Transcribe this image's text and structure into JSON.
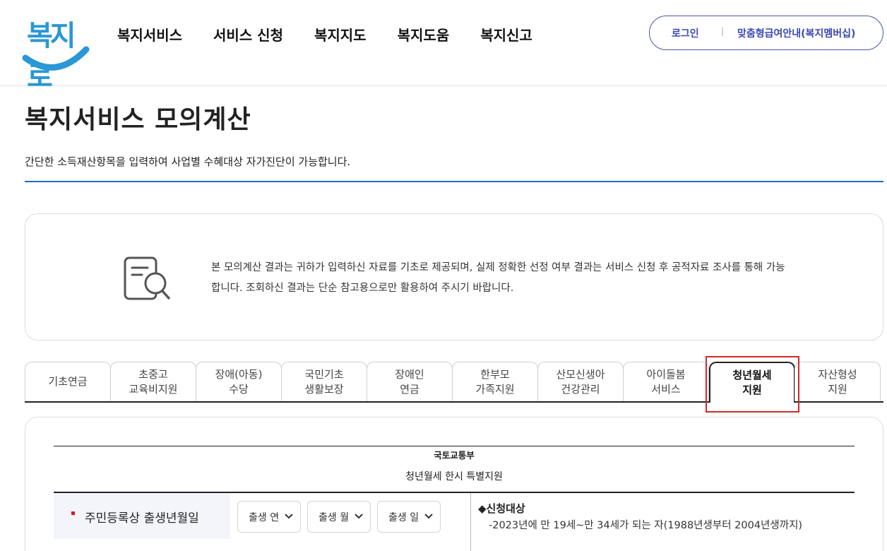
{
  "header": {
    "logo_text": "복지로",
    "nav": [
      "복지서비스",
      "서비스 신청",
      "복지지도",
      "복지도움",
      "복지신고"
    ],
    "util": {
      "login": "로그인",
      "separator": "|",
      "member": "맞춤형급여안내(복지멤버십)"
    }
  },
  "page": {
    "title": "복지서비스 모의계산",
    "description": "간단한 소득재산항목을 입력하여 사업별 수혜대상 자가진단이 가능합니다."
  },
  "notice": {
    "icon": "document-search-icon",
    "text": "본 모의계산 결과는 귀하가 입력하신 자료를 기초로 제공되며, 실제 정확한 선정 여부 결과는 서비스 신청 후 공적자료 조사를 통해 가능합니다. 조회하신 결과는 단순 참고용으로만 활용하여 주시기 바랍니다."
  },
  "tabs": [
    {
      "label": "기초연금"
    },
    {
      "label": "초중고\n교육비지원"
    },
    {
      "label": "장애(아동)\n수당"
    },
    {
      "label": "국민기초\n생활보장"
    },
    {
      "label": "장애인\n연금"
    },
    {
      "label": "한부모\n가족지원"
    },
    {
      "label": "산모신생아\n건강관리"
    },
    {
      "label": "아이돌봄\n서비스"
    },
    {
      "label": "청년월세\n지원",
      "active": true
    },
    {
      "label": "자산형성\n지원"
    }
  ],
  "service": {
    "ministry": "국토교통부",
    "name": "청년월세 한시 특별지원",
    "field_label": "주민등록상 출생년월일",
    "selects": [
      "출생 연",
      "출생 월",
      "출생 일"
    ],
    "criteria_title": "◆신청대상",
    "criteria_text": "-2023년에 만 19세~만 34세가 되는 자(1988년생부터 2004년생까지)"
  },
  "colors": {
    "brand_blue": "#2a97d6",
    "util_border": "#4a55b8",
    "title_line": "#1a6ec2",
    "highlight": "#d9262b",
    "required": "#e0171e"
  }
}
